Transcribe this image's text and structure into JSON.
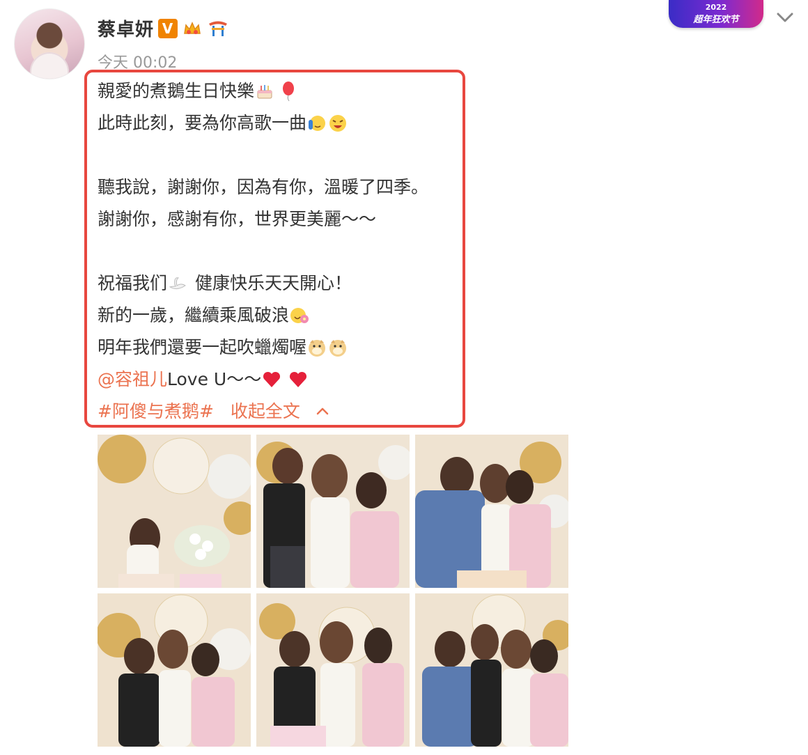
{
  "user": {
    "name": "蔡卓妍",
    "verified_badge": "V",
    "timestamp": "今天 00:02"
  },
  "promo": {
    "year": "2022",
    "name": "超年狂欢节"
  },
  "post": {
    "lines": [
      "親愛的煮鵝生日快樂",
      "此時此刻，要為你高歌一曲",
      "",
      "聽我說，謝謝你，因為有你，溫暖了四季。",
      "謝謝你，感謝有你，世界更美麗～～",
      "",
      "祝福我们",
      "健康快乐天天開心！",
      "新的一歲，繼續乘風破浪",
      "明年我們還要一起吹蠟燭喔"
    ],
    "mention": "@容祖儿",
    "mention_suffix": " Love U～～",
    "hashtag": "#阿傻与煮鹅#",
    "collapse_label": "收起全文"
  },
  "icons": {
    "more": "chevron-down-icon",
    "collapse": "chevron-up-icon",
    "emoji": [
      "cake-icon",
      "balloon-icon",
      "singing-icon",
      "laughing-icon",
      "swan-icon",
      "flower-face-icon",
      "doge-icon",
      "heart-icon"
    ]
  },
  "colors": {
    "accent": "#eb7350",
    "highlight_border": "#e8473f",
    "verified": "#f08300",
    "timestamp": "#999999",
    "text": "#333333"
  },
  "photos": [
    "photo-1",
    "photo-2",
    "photo-3",
    "photo-4",
    "photo-5",
    "photo-6"
  ]
}
